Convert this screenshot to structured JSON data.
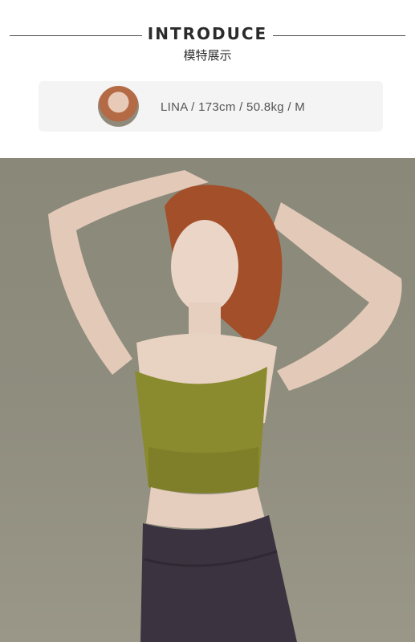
{
  "header": {
    "title": "INTRODUCE",
    "subtitle": "模特展示"
  },
  "model": {
    "info": "LINA / 173cm / 50.8kg / M"
  },
  "colors": {
    "top": "#8a8a2e",
    "leggings": "#3b3440",
    "background": "#8d8b7c",
    "skin": "#e8d2c2",
    "hair": "#a24f2a"
  }
}
